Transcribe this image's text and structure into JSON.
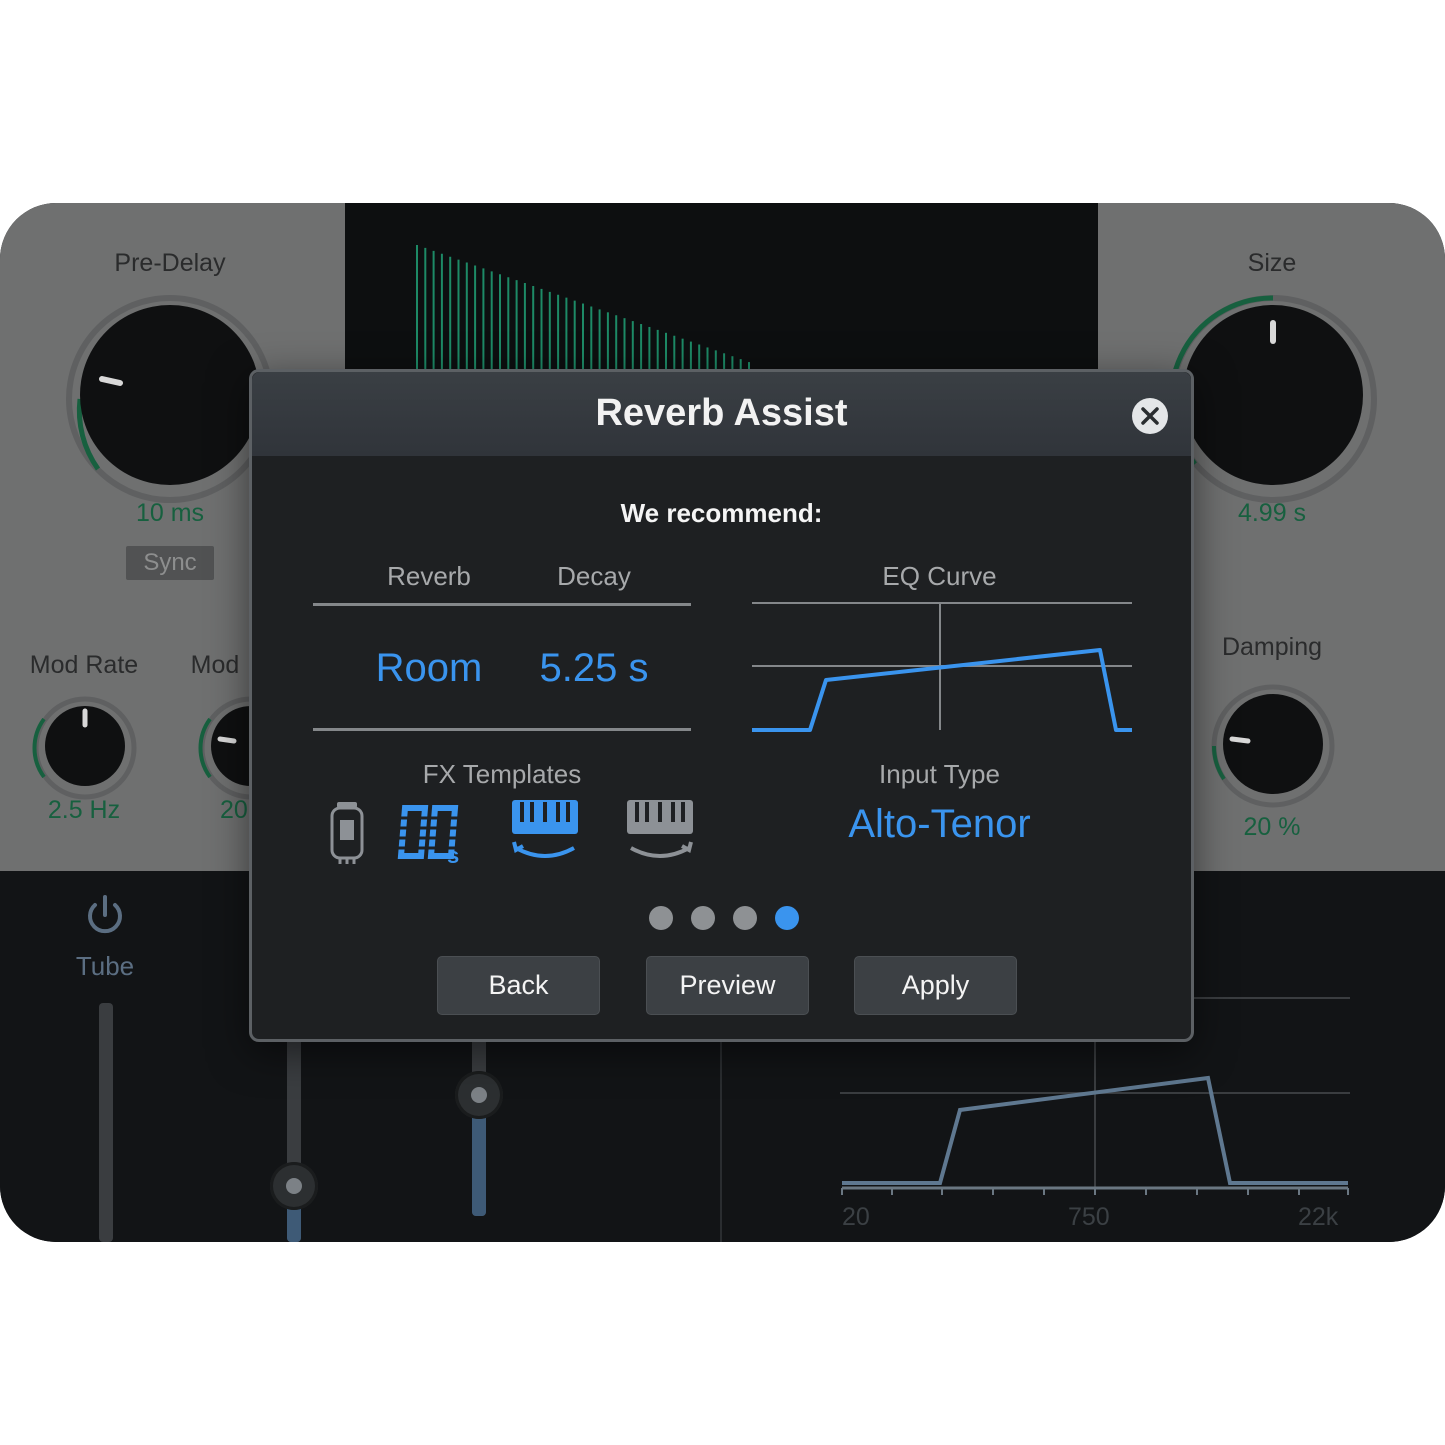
{
  "plugin": {
    "pre_delay": {
      "label": "Pre-Delay",
      "value": "10 ms"
    },
    "sync": {
      "label": "Sync"
    },
    "mod_rate": {
      "label": "Mod Rate",
      "value": "2.5 Hz"
    },
    "mod_depth": {
      "label": "Mod",
      "value": "20"
    },
    "size": {
      "label": "Size",
      "value": "4.99 s"
    },
    "damping": {
      "label": "Damping",
      "value": "20 %"
    },
    "tube": {
      "label": "Tube"
    },
    "freq_axis": {
      "labels": [
        "20",
        "750",
        "22k"
      ]
    }
  },
  "modal": {
    "title": "Reverb Assist",
    "subtitle": "We recommend:",
    "columns": {
      "reverb": "Reverb",
      "decay": "Decay",
      "eq_curve": "EQ Curve"
    },
    "values": {
      "reverb": "Room",
      "decay": "5.25 s"
    },
    "fx_templates": {
      "label": "FX Templates",
      "items": [
        {
          "icon": "tube-icon",
          "selected": false
        },
        {
          "icon": "80s-icon",
          "selected": true
        },
        {
          "icon": "keys-down-icon",
          "selected": true
        },
        {
          "icon": "keys-up-icon",
          "selected": false
        }
      ]
    },
    "input_type": {
      "label": "Input Type",
      "value": "Alto-Tenor"
    },
    "pagination": {
      "total": 4,
      "active": 4
    },
    "buttons": {
      "back": "Back",
      "preview": "Preview",
      "apply": "Apply"
    }
  },
  "colors": {
    "accent": "#3a94ee",
    "knob_ring": "#2a8a5c",
    "display_line": "#1d8a66"
  }
}
